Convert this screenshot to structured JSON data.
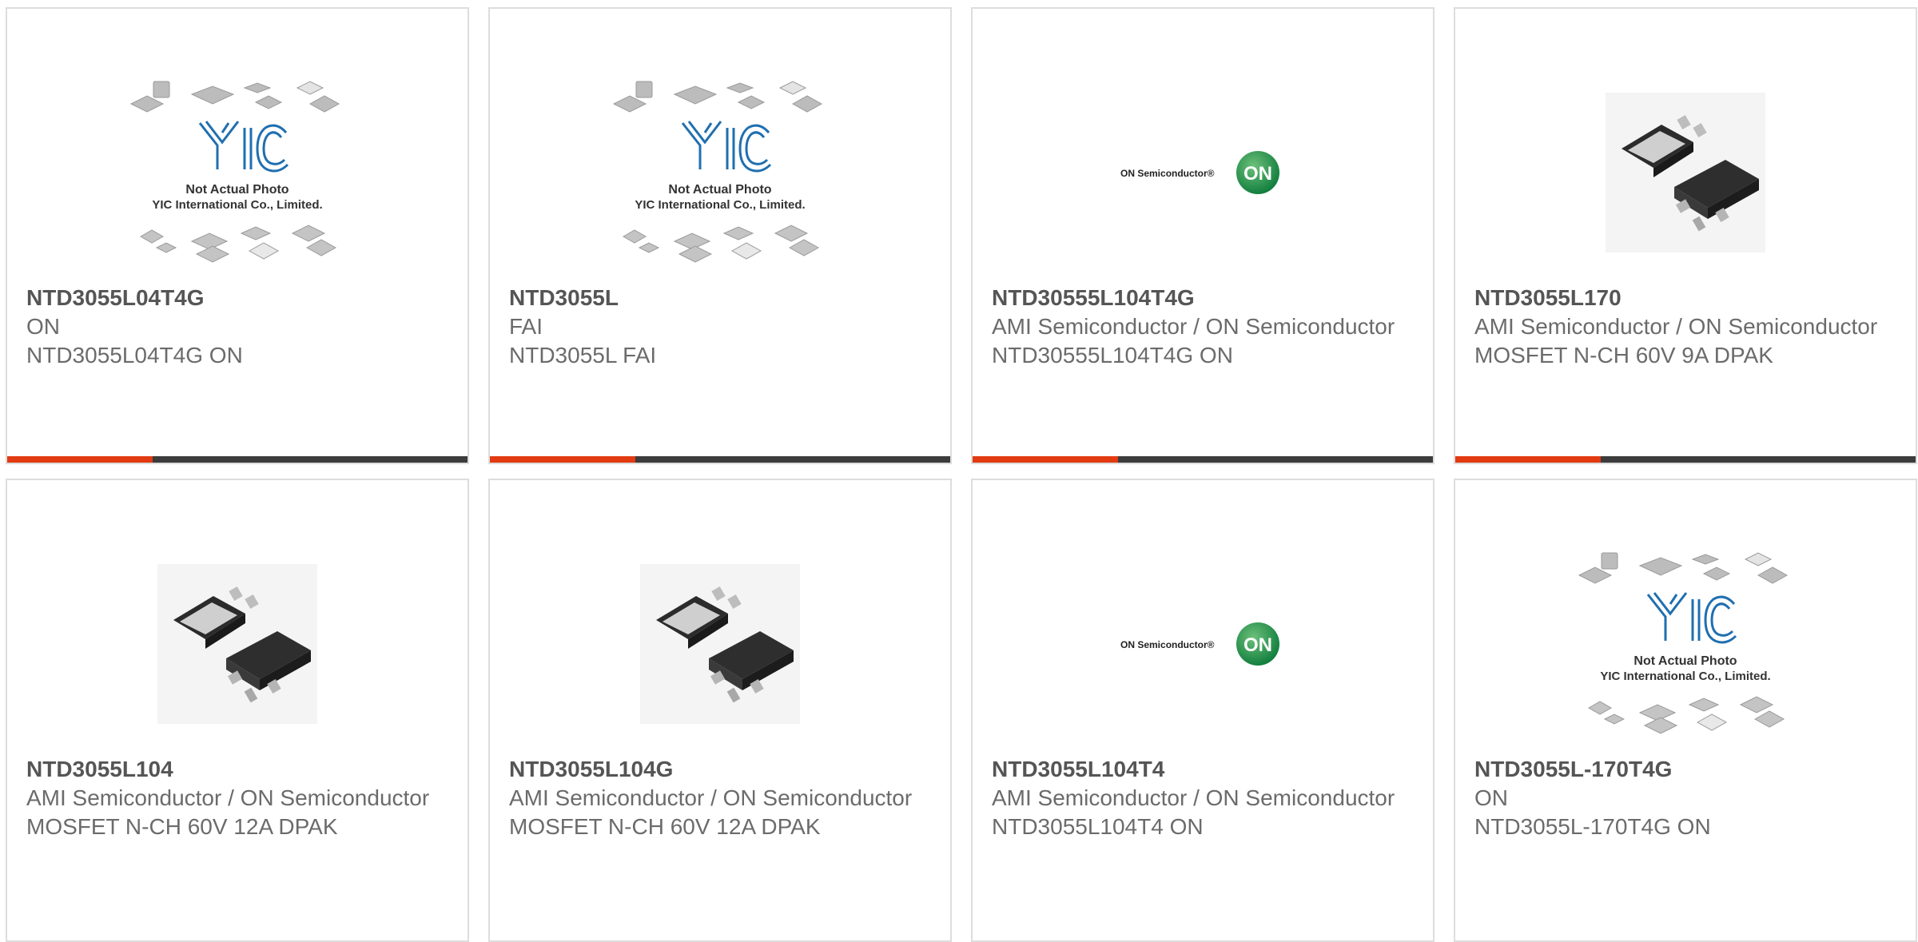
{
  "products": [
    {
      "part": "NTD3055L04T4G",
      "maker": "ON",
      "desc": "NTD3055L04T4G ON",
      "image": "generic-not-actual-photo",
      "placeholder_line1": "Not Actual Photo",
      "placeholder_line2": "YIC International Co., Limited.",
      "placeholder_logo": "YIC"
    },
    {
      "part": "NTD3055L",
      "maker": "FAI",
      "desc": "NTD3055L FAI",
      "image": "generic-not-actual-photo",
      "placeholder_line1": "Not Actual Photo",
      "placeholder_line2": "YIC International Co., Limited.",
      "placeholder_logo": "YIC"
    },
    {
      "part": "NTD30555L104T4G",
      "maker": "AMI Semiconductor / ON Semiconductor",
      "desc": "NTD30555L104T4G ON",
      "image": "on-semiconductor-logo",
      "logo_text": "ON Semiconductor®",
      "logo_badge": "ON"
    },
    {
      "part": "NTD3055L170",
      "maker": "AMI Semiconductor / ON Semiconductor",
      "desc": "MOSFET N-CH 60V 9A DPAK",
      "image": "dpak-package"
    },
    {
      "part": "NTD3055L104",
      "maker": "AMI Semiconductor / ON Semiconductor",
      "desc": "MOSFET N-CH 60V 12A DPAK",
      "image": "dpak-package"
    },
    {
      "part": "NTD3055L104G",
      "maker": "AMI Semiconductor / ON Semiconductor",
      "desc": "MOSFET N-CH 60V 12A DPAK",
      "image": "dpak-package"
    },
    {
      "part": "NTD3055L104T4",
      "maker": "AMI Semiconductor / ON Semiconductor",
      "desc": "NTD3055L104T4 ON",
      "image": "on-semiconductor-logo",
      "logo_text": "ON Semiconductor®",
      "logo_badge": "ON"
    },
    {
      "part": "NTD3055L-170T4G",
      "maker": "ON",
      "desc": "NTD3055L-170T4G ON",
      "image": "generic-not-actual-photo",
      "placeholder_line1": "Not Actual Photo",
      "placeholder_line2": "YIC International Co., Limited.",
      "placeholder_logo": "YIC"
    }
  ],
  "colors": {
    "accent": "#e23b12",
    "bar": "#3c3c3c",
    "border": "#dddddd",
    "text": "#6b6b6b"
  }
}
